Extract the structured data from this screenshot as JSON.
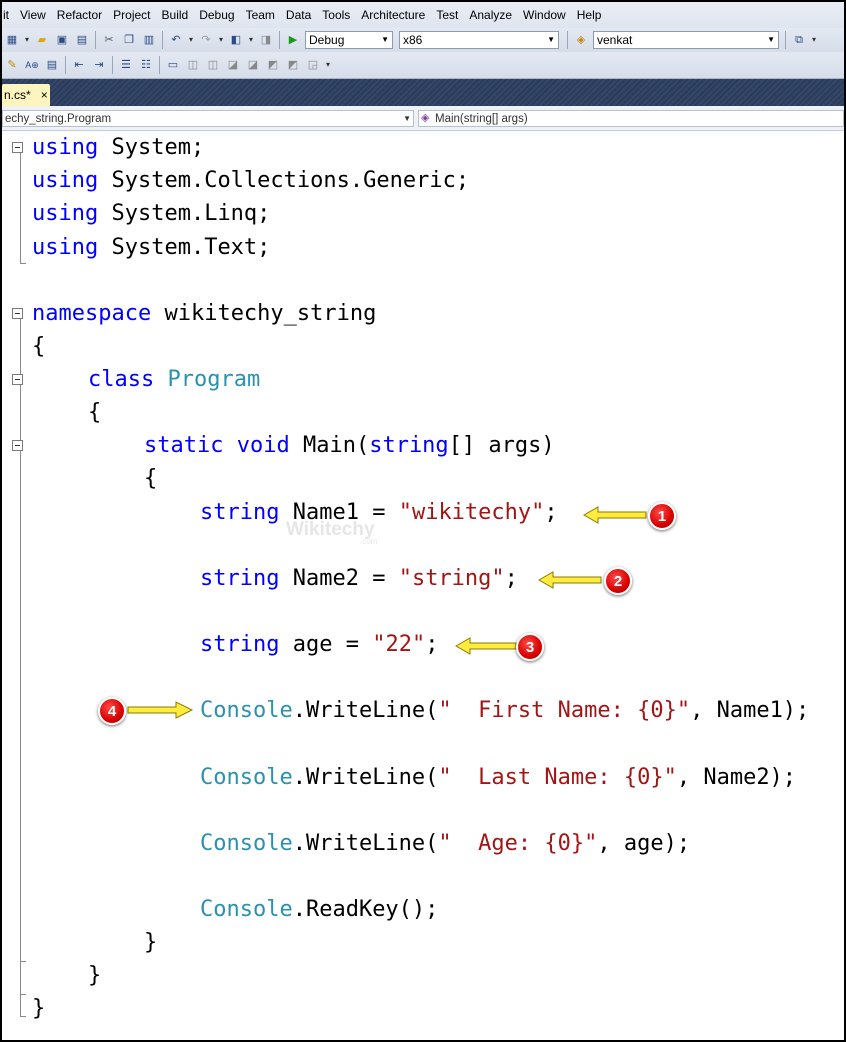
{
  "menu": [
    "it",
    "View",
    "Refactor",
    "Project",
    "Build",
    "Debug",
    "Team",
    "Data",
    "Tools",
    "Architecture",
    "Test",
    "Analyze",
    "Window",
    "Help"
  ],
  "toolbar": {
    "configuration": "Debug",
    "platform": "x86",
    "find_box": "venkat"
  },
  "tab": {
    "label": "n.cs*",
    "close": "×"
  },
  "navbar": {
    "type_combo": "echy_string.Program",
    "member_combo": "Main(string[] args)"
  },
  "code": {
    "l1": [
      "using",
      " System;"
    ],
    "l2": [
      "using",
      " System.Collections.Generic;"
    ],
    "l3": [
      "using",
      " System.Linq;"
    ],
    "l4": [
      "using",
      " System.Text;"
    ],
    "l5": [
      "namespace",
      " wikitechy_string"
    ],
    "l6": "{",
    "l7": [
      "class",
      "Program"
    ],
    "l8": "{",
    "l9": [
      "static",
      "void",
      "Main(",
      "string",
      "[] args)"
    ],
    "l10": "{",
    "l11": [
      "string",
      " Name1 = ",
      "\"wikitechy\"",
      ";"
    ],
    "l12": [
      "string",
      " Name2 = ",
      "\"string\"",
      ";"
    ],
    "l13": [
      "string",
      " age = ",
      "\"22\"",
      ";"
    ],
    "l14": [
      "Console",
      ".WriteLine(",
      "\"  First Name: {0}\"",
      ", Name1);"
    ],
    "l15": [
      "Console",
      ".WriteLine(",
      "\"  Last Name: {0}\"",
      ", Name2);"
    ],
    "l16": [
      "Console",
      ".WriteLine(",
      "\"  Age: {0}\"",
      ", age);"
    ],
    "l17": [
      "Console",
      ".ReadKey();"
    ],
    "l18": "}",
    "l19": "}",
    "l20": "}"
  },
  "annotations": [
    "1",
    "2",
    "3",
    "4"
  ],
  "watermark": {
    "text": "Wikitechy",
    "domain": ".com"
  }
}
